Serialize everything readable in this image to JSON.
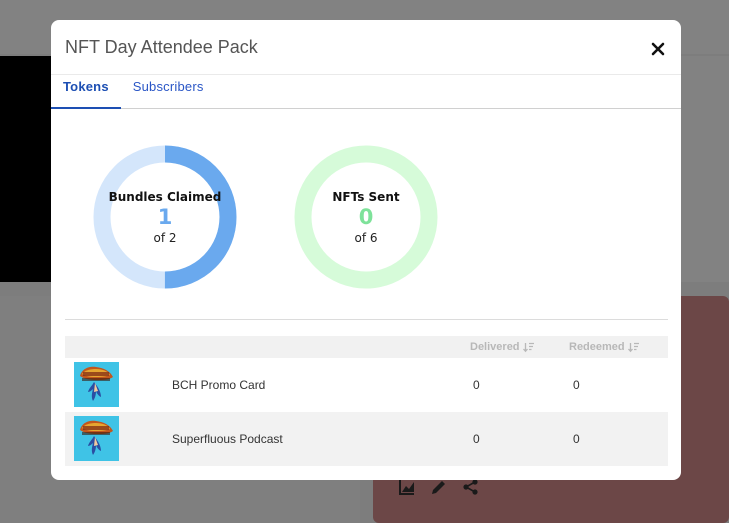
{
  "modal": {
    "title": "NFT Day Attendee Pack",
    "close_icon": "close-icon"
  },
  "tabs": [
    {
      "label": "Tokens",
      "active": true
    },
    {
      "label": "Subscribers",
      "active": false
    }
  ],
  "stats": [
    {
      "label": "Bundles Claimed",
      "value": "1",
      "of_text": "of 2",
      "fraction": 0.5,
      "color": "#6aa9ee",
      "track": "#d4e6fb"
    },
    {
      "label": "NFTs Sent",
      "value": "0",
      "of_text": "of 6",
      "fraction": 0,
      "color": "#7ee29a",
      "track": "#d6fbd9"
    }
  ],
  "table": {
    "headers": {
      "delivered": "Delivered",
      "redeemed": "Redeemed"
    },
    "rows": [
      {
        "name": "BCH Promo Card",
        "delivered": "0",
        "redeemed": "0",
        "thumb_icon": "nft-thumbnail-icon"
      },
      {
        "name": "Superfluous Podcast",
        "delivered": "0",
        "redeemed": "0",
        "thumb_icon": "nft-thumbnail-icon"
      }
    ]
  },
  "background": {
    "accent_red": "#6c4747",
    "icons": [
      "chart-icon",
      "edit-icon",
      "share-icon"
    ]
  }
}
